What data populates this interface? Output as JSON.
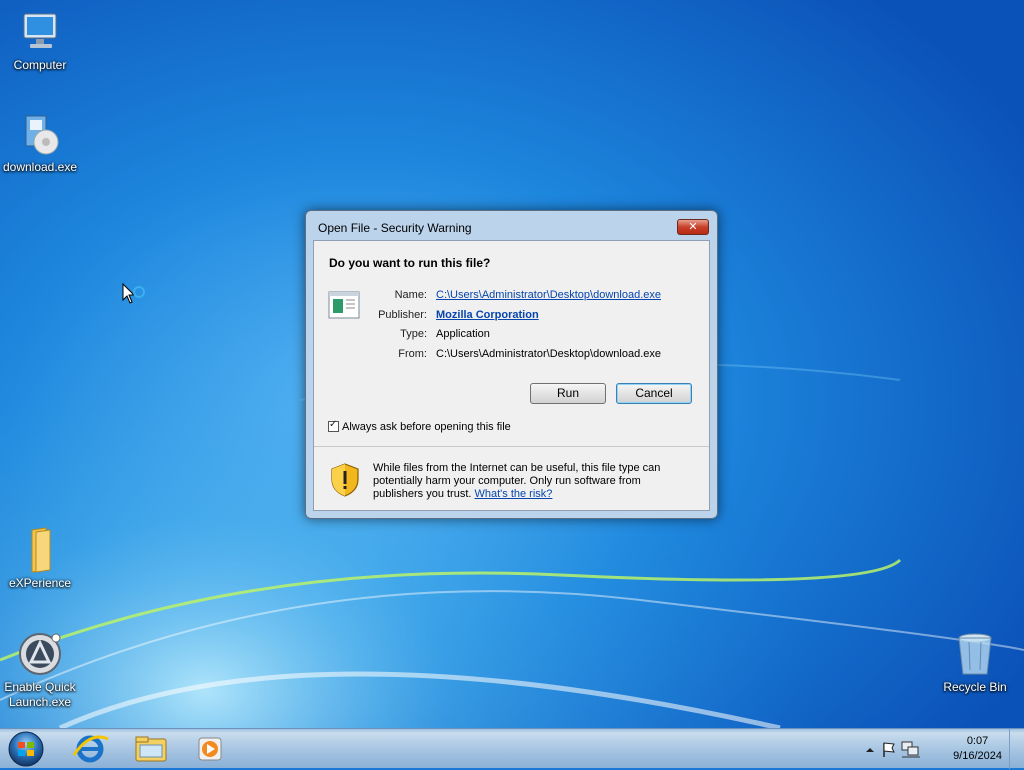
{
  "desktop": {
    "icons": [
      {
        "label": "Computer"
      },
      {
        "label": "download.exe"
      },
      {
        "label": "eXPerience"
      },
      {
        "label": "Enable Quick Launch.exe"
      },
      {
        "label": "Recycle Bin"
      }
    ]
  },
  "dialog": {
    "title": "Open File - Security Warning",
    "close_label": "✕",
    "question": "Do you want to run this file?",
    "fields": {
      "name_key": "Name:",
      "name_val": "C:\\Users\\Administrator\\Desktop\\download.exe",
      "publisher_key": "Publisher:",
      "publisher_val": "Mozilla Corporation",
      "type_key": "Type:",
      "type_val": "Application",
      "from_key": "From:",
      "from_val": "C:\\Users\\Administrator\\Desktop\\download.exe"
    },
    "run_label": "Run",
    "cancel_label": "Cancel",
    "always_ask_label": "Always ask before opening this file",
    "always_ask_checked": true,
    "warning_text": "While files from the Internet can be useful, this file type can potentially harm your computer. Only run software from publishers you trust.",
    "risk_link": "What's the risk?"
  },
  "taskbar": {
    "clock_time": "0:07",
    "clock_date": "9/16/2024",
    "pinned": [
      "internet-explorer-icon",
      "windows-explorer-icon",
      "media-player-icon"
    ]
  },
  "colors": {
    "desktop_blue": "#1a78d6",
    "dialog_frame": "#bcd3ec",
    "link": "#0645ad"
  }
}
